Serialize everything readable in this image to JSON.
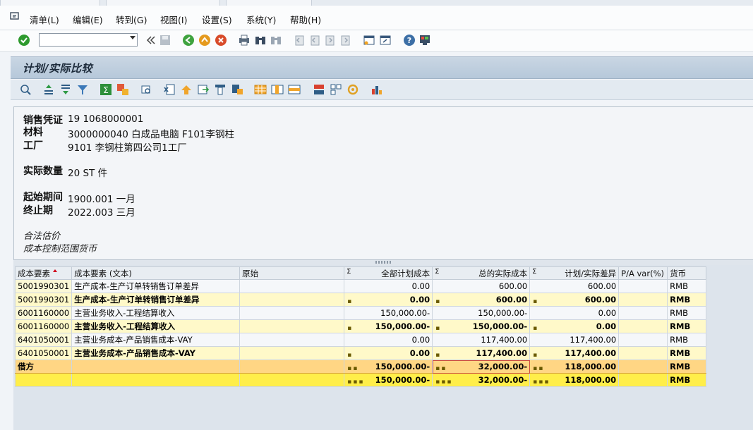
{
  "menu": [
    "清单(L)",
    "编辑(E)",
    "转到(G)",
    "视图(I)",
    "设置(S)",
    "系统(Y)",
    "帮助(H)"
  ],
  "command_field": {
    "value": ""
  },
  "title": "计划/实际比较",
  "header": {
    "sales_doc_label": "销售凭证",
    "sales_doc_value": "19 1068000001",
    "material_label": "材料",
    "material_value": "3000000040 白成品电脑 F101李钢柱",
    "plant_label": "工厂",
    "plant_value": "9101 李钢柱第四公司1工厂",
    "actual_qty_label": "实际数量",
    "actual_qty_value": "20 ST 件",
    "start_period_label": "起始期间",
    "start_period_value": "1900.001 一月",
    "end_period_label": "终止期",
    "end_period_value": "2022.003 三月",
    "note1": "合法估价",
    "note2": "成本控制范围货币"
  },
  "grid": {
    "columns": [
      "成本要素",
      "成本要素 (文本)",
      "原始",
      "全部计划成本",
      "总的实际成本",
      "计划/实际差异",
      "P/A var(%)",
      "货币"
    ],
    "sigma": "Σ",
    "rows": [
      {
        "type": "item",
        "key": "5001990301",
        "text": "生产成本-生产订单转销售订单差异",
        "origin": "",
        "plan": "0.00",
        "actual": "600.00",
        "diff": "600.00",
        "pct": "",
        "cur": "RMB"
      },
      {
        "type": "sub",
        "key": "5001990301",
        "text": "生产成本-生产订单转销售订单差异",
        "origin": "",
        "plan": "0.00",
        "actual": "600.00",
        "diff": "600.00",
        "pct": "",
        "cur": "RMB"
      },
      {
        "type": "item",
        "key": "6001160000",
        "text": "主营业务收入-工程结算收入",
        "origin": "",
        "plan": "150,000.00-",
        "actual": "150,000.00-",
        "diff": "0.00",
        "pct": "",
        "cur": "RMB"
      },
      {
        "type": "sub",
        "key": "6001160000",
        "text": "主营业务收入-工程结算收入",
        "origin": "",
        "plan": "150,000.00-",
        "actual": "150,000.00-",
        "diff": "0.00",
        "pct": "",
        "cur": "RMB"
      },
      {
        "type": "item",
        "key": "6401050001",
        "text": "主营业务成本-产品销售成本-VAY",
        "origin": "",
        "plan": "0.00",
        "actual": "117,400.00",
        "diff": "117,400.00",
        "pct": "",
        "cur": "RMB"
      },
      {
        "type": "sub",
        "key": "6401050001",
        "text": "主营业务成本-产品销售成本-VAY",
        "origin": "",
        "plan": "0.00",
        "actual": "117,400.00",
        "diff": "117,400.00",
        "pct": "",
        "cur": "RMB"
      },
      {
        "type": "group",
        "key": "借方",
        "text": "",
        "origin": "",
        "plan": "150,000.00-",
        "actual": "32,000.00-",
        "diff": "118,000.00",
        "pct": "",
        "cur": "RMB"
      },
      {
        "type": "total",
        "key": "",
        "text": "",
        "origin": "",
        "plan": "150,000.00-",
        "actual": "32,000.00-",
        "diff": "118,000.00",
        "pct": "",
        "cur": "RMB"
      }
    ]
  }
}
